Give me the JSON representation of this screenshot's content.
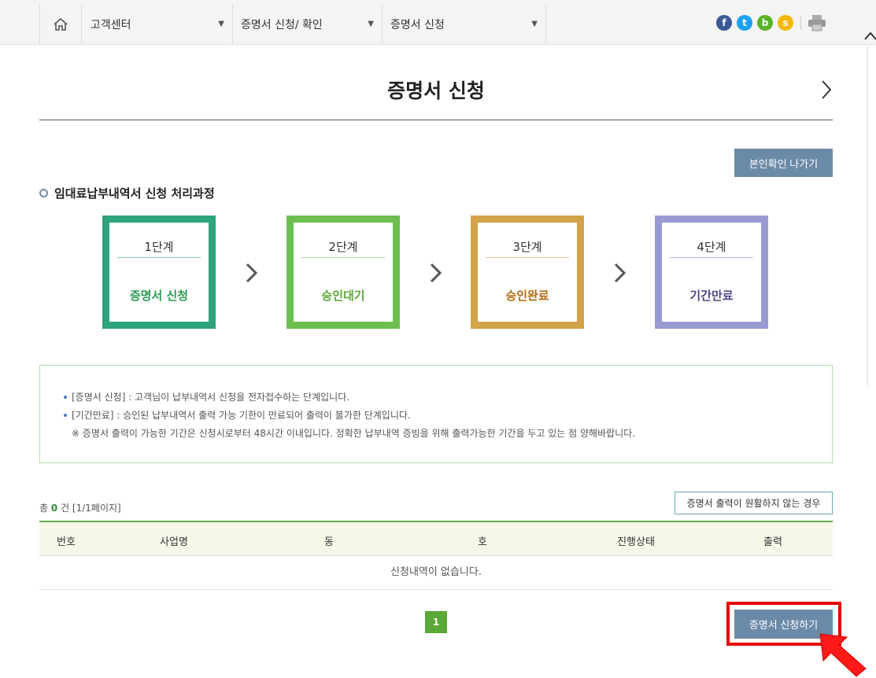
{
  "topbar": {
    "home_icon": "home-icon",
    "dropdowns": [
      {
        "label": "고객센터"
      },
      {
        "label": "증명서 신청/ 확인"
      },
      {
        "label": "증명서 신청"
      }
    ],
    "social": [
      {
        "name": "facebook-icon",
        "glyph": "f",
        "color": "#3b5998"
      },
      {
        "name": "twitter-icon",
        "glyph": "t",
        "color": "#1da1f2"
      },
      {
        "name": "band-icon",
        "glyph": "b",
        "color": "#59b32a"
      },
      {
        "name": "kakaostory-icon",
        "glyph": "s",
        "color": "#f5b800"
      }
    ],
    "print_icon": "print-icon",
    "dropdown_arrow": "▼"
  },
  "page": {
    "title": "증명서 신청",
    "exit_button": "본인확인 나가기"
  },
  "process": {
    "heading": "임대료납부내역서 신청 처리과정",
    "steps": [
      {
        "stage": "1단계",
        "name": "증명서 신청",
        "color": "#2fa57b"
      },
      {
        "stage": "2단계",
        "name": "승인대기",
        "color": "#6cbf4f"
      },
      {
        "stage": "3단계",
        "name": "승인완료",
        "color": "#d3a34a"
      },
      {
        "stage": "4단계",
        "name": "기간만료",
        "color": "#9a9ad2"
      }
    ]
  },
  "info": {
    "line1": "[증명서 신청] : 고객님이 납부내역서 신청을 전자접수하는 단계입니다.",
    "line2": "[기간만료] : 승인된 납부내역서 출력 가능 기한이 만료되어 출력이 불가한 단계입니다.",
    "note": "※ 증명서 출력이 가능한 기간은 신청시로부터 48시간 이내입니다. 정확한 납부내역 증빙을 위해 출력가능한 기간을 두고 있는 점 양해바랍니다."
  },
  "list": {
    "total_prefix": "총",
    "total_count": "0",
    "total_suffix": "건 [1/1페이지]",
    "help_button": "증명서 출력이 원활하지 않는 경우",
    "columns": [
      "번호",
      "사업명",
      "동",
      "호",
      "진행상태",
      "출력"
    ],
    "empty_message": "신청내역이 없습니다."
  },
  "pagination": {
    "current": "1"
  },
  "apply_button": "증명서 신청하기"
}
